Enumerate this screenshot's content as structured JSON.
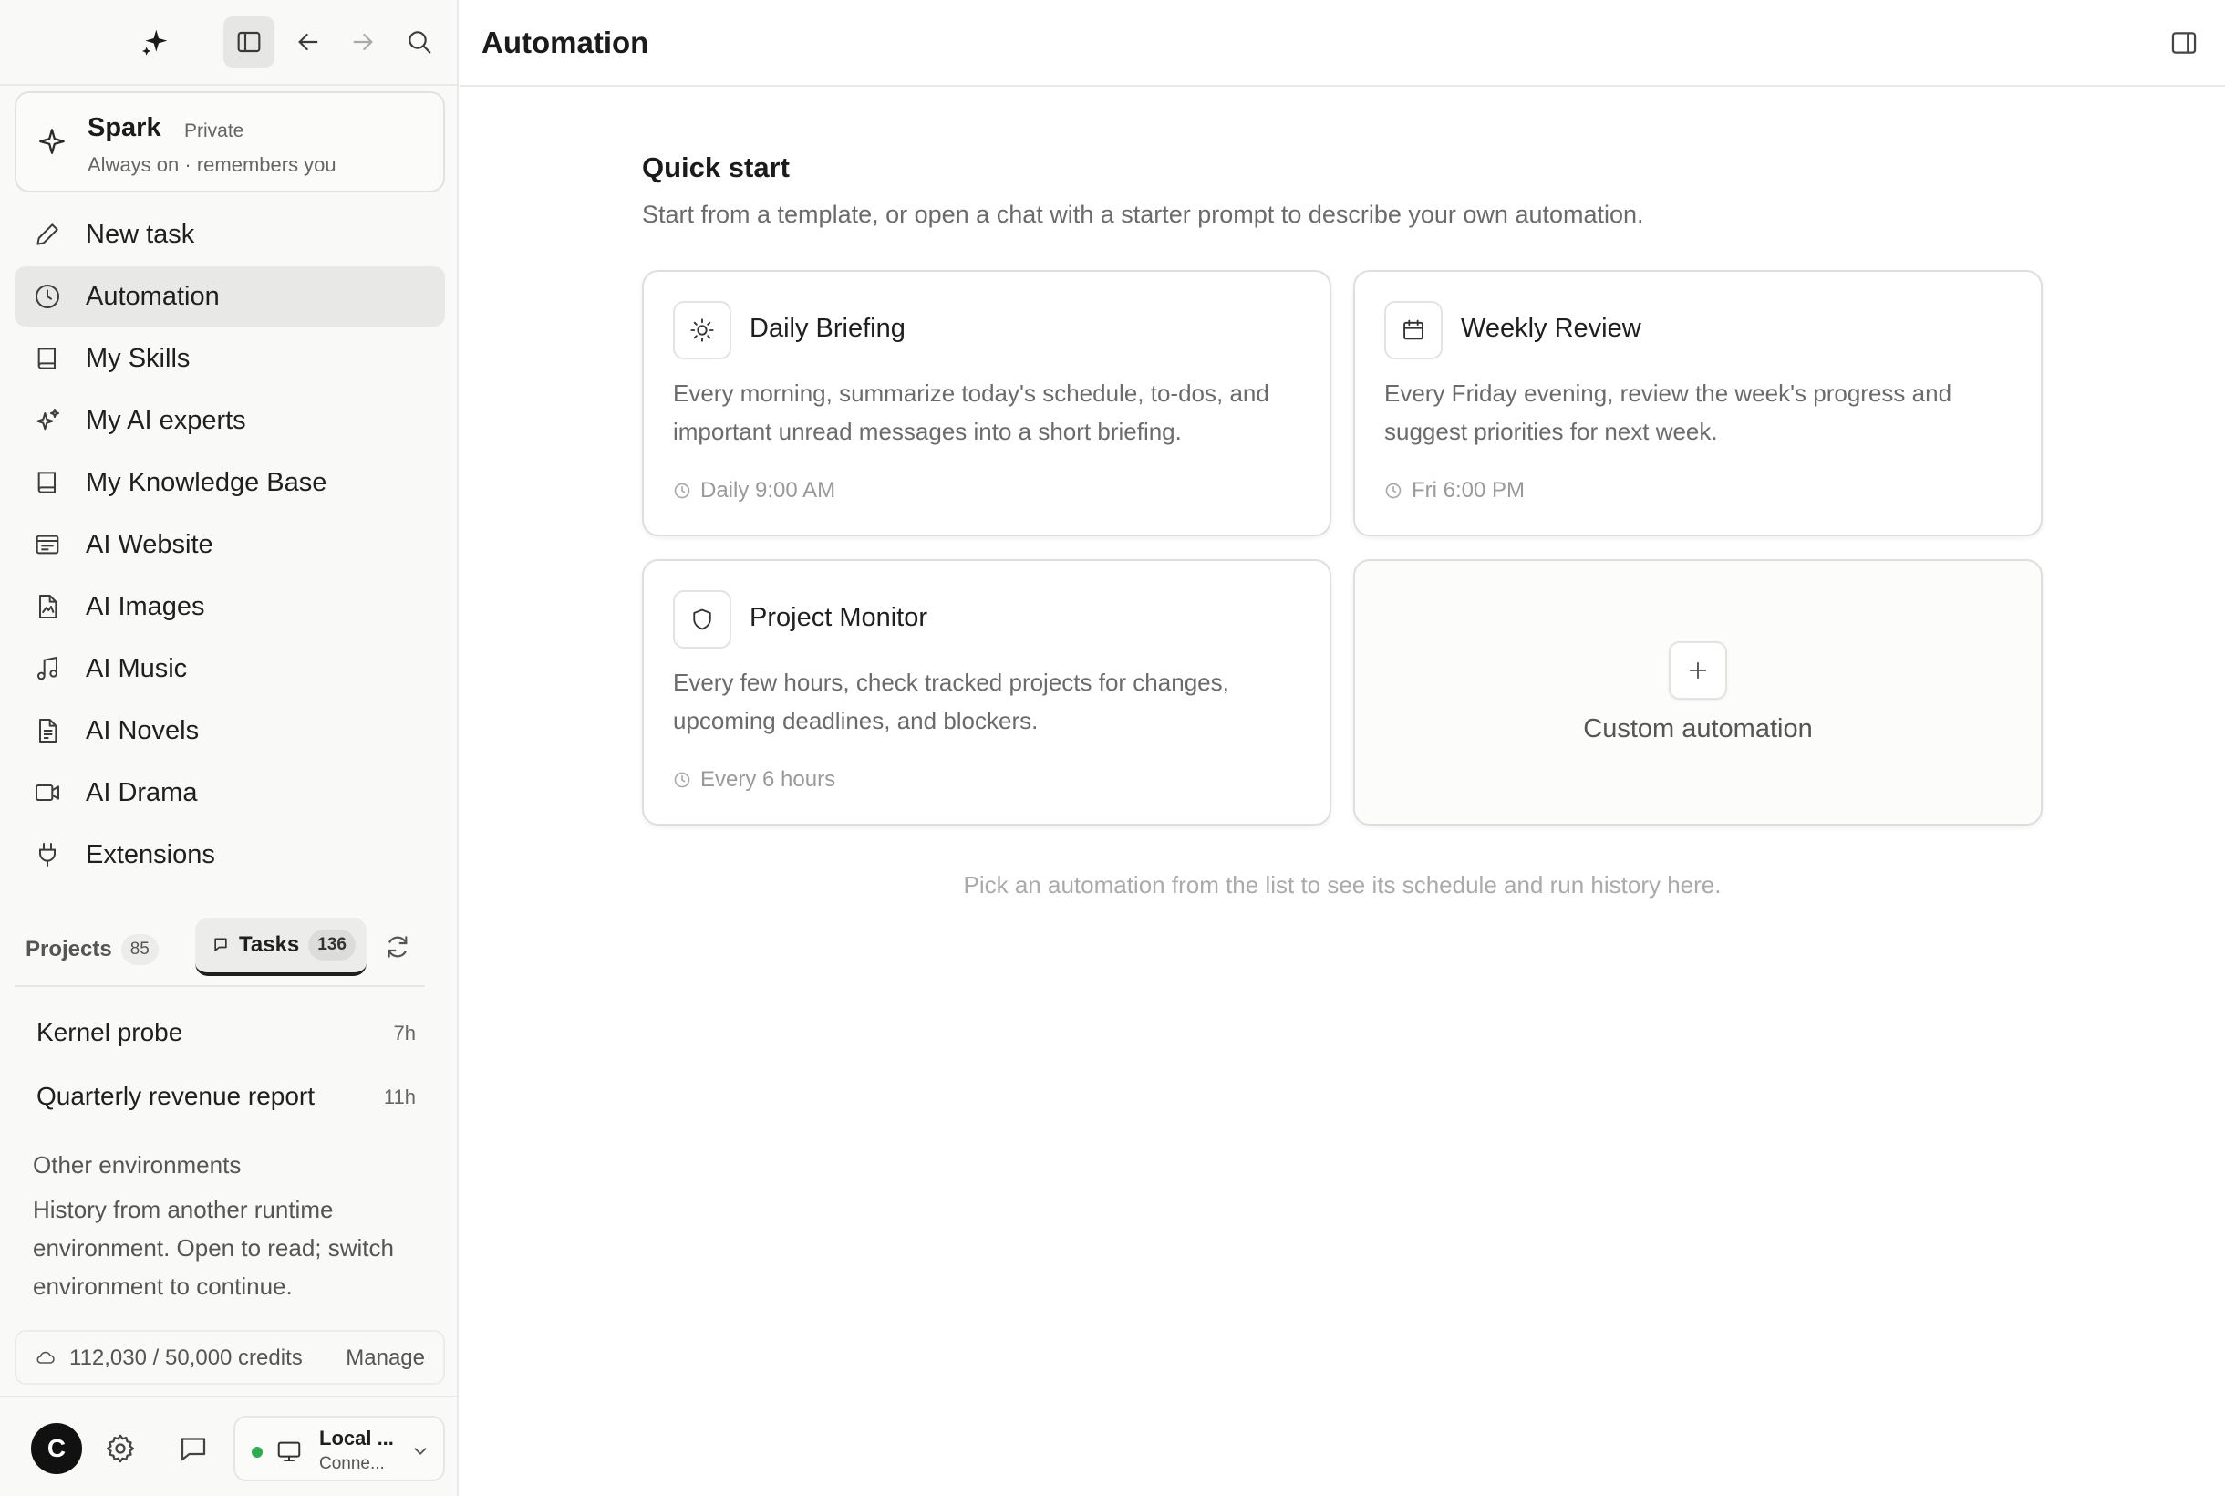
{
  "sidebar": {
    "spark": {
      "title": "Spark",
      "badge": "Private",
      "subtitle": "Always on · remembers you"
    },
    "nav": [
      {
        "label": "New task",
        "icon": "pencil-icon"
      },
      {
        "label": "Automation",
        "icon": "clock-icon",
        "active": true
      },
      {
        "label": "My Skills",
        "icon": "book-icon"
      },
      {
        "label": "My AI experts",
        "icon": "sparkles-icon"
      },
      {
        "label": "My Knowledge Base",
        "icon": "book-icon"
      },
      {
        "label": "AI Website",
        "icon": "website-icon"
      },
      {
        "label": "AI Images",
        "icon": "image-file-icon"
      },
      {
        "label": "AI Music",
        "icon": "music-icon"
      },
      {
        "label": "AI Novels",
        "icon": "document-icon"
      },
      {
        "label": "AI Drama",
        "icon": "video-icon"
      },
      {
        "label": "Extensions",
        "icon": "plug-icon"
      }
    ],
    "tabs": {
      "projects_label": "Projects",
      "projects_count": "85",
      "tasks_label": "Tasks",
      "tasks_count": "136"
    },
    "tasks": [
      {
        "name": "Kernel probe",
        "time": "7h"
      },
      {
        "name": "Quarterly revenue report",
        "time": "11h"
      }
    ],
    "other_env": {
      "heading": "Other environments",
      "description": "History from another runtime environment. Open to read; switch environment to continue."
    },
    "credits": {
      "value": "112,030 / 50,000 credits",
      "manage": "Manage"
    },
    "footer": {
      "avatar_letter": "C",
      "env_name": "Local ...",
      "env_status": "Conne...",
      "status_color": "#2eaa4f"
    }
  },
  "main": {
    "title": "Automation",
    "quick_start": {
      "title": "Quick start",
      "subtitle": "Start from a template, or open a chat with a starter prompt to describe your own automation."
    },
    "templates": [
      {
        "title": "Daily Briefing",
        "icon": "sun-icon",
        "description": "Every morning, summarize today's schedule, to-dos, and important unread messages into a short briefing.",
        "schedule": "Daily 9:00 AM"
      },
      {
        "title": "Weekly Review",
        "icon": "calendar-icon",
        "description": "Every Friday evening, review the week's progress and suggest priorities for next week.",
        "schedule": "Fri 6:00 PM"
      },
      {
        "title": "Project Monitor",
        "icon": "shield-icon",
        "description": "Every few hours, check tracked projects for changes, upcoming deadlines, and blockers.",
        "schedule": "Every 6 hours"
      }
    ],
    "custom_label": "Custom automation",
    "hint": "Pick an automation from the list to see its schedule and run history here."
  }
}
